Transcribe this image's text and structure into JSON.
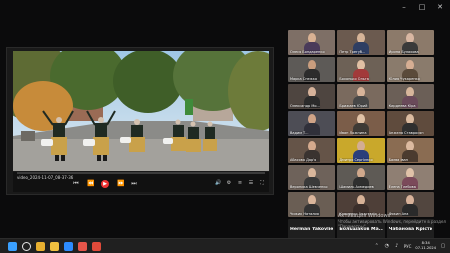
{
  "window_controls": [
    "minimize",
    "maximize",
    "close"
  ],
  "player": {
    "file_name": "video_2024-11-07_08-37-36",
    "progress": 0.0,
    "controls": [
      "prev-icon",
      "rewind-icon",
      "play-icon",
      "forward-icon",
      "next-icon"
    ],
    "right_controls": [
      "volume-icon",
      "settings-icon",
      "subtitles-icon",
      "playlist-icon",
      "fullscreen-icon"
    ]
  },
  "participants": [
    {
      "name": "Олеся Бондаренко",
      "skin": "#d9b193",
      "shirt": "#4a3a5a",
      "bg": "#7e6f66"
    },
    {
      "name": "Петр Трегуб...",
      "skin": "#d6b498",
      "shirt": "#2e3e63",
      "bg": "#6b5a4f"
    },
    {
      "name": "Ирина Булахова",
      "skin": "#d9b7a2",
      "shirt": "#3a3a3a",
      "bg": "#8c7a6a"
    },
    {
      "name": "Марка Снежко",
      "skin": "#c99d7e",
      "shirt": "#2c2c2c",
      "bg": "#5d5a57"
    },
    {
      "name": "Бохонько Ольга",
      "skin": "#e0c0a4",
      "shirt": "#a23a3a",
      "bg": "#6d6156"
    },
    {
      "name": "Юлия Чукаренко",
      "skin": "#d6ae93",
      "shirt": "#5a4a3a",
      "bg": "#8a7b6c"
    },
    {
      "name": "Олександр Мо...",
      "skin": "#d6b29a",
      "shirt": "#2b2b2b",
      "bg": "#4e4540"
    },
    {
      "name": "Брижаев Юрий",
      "skin": "#d8b49a",
      "shirt": "#474747",
      "bg": "#7a6a5e"
    },
    {
      "name": "Кирдеева Кіра",
      "skin": "#d7b69b",
      "shirt": "#6a4a5a",
      "bg": "#6b5f57"
    },
    {
      "name": "Вадим Т...",
      "skin": "#cfa387",
      "shirt": "#30303a",
      "bg": "#4d4d55"
    },
    {
      "name": "Иван Ложнина",
      "skin": "#e1c2a6",
      "shirt": "#3e3a35",
      "bg": "#7b5d49"
    },
    {
      "name": "Анжела Ставросян",
      "skin": "#dbbba0",
      "shirt": "#2f2f2f",
      "bg": "#5f4b3d"
    },
    {
      "name": "Абасова Дар'я",
      "skin": "#d4aa8e",
      "shirt": "#3a3330",
      "bg": "#655448"
    },
    {
      "name": "Дмитро Сергієнко",
      "skin": "#d3ad93",
      "shirt": "#2a3f7a",
      "bg": "#c9a82b"
    },
    {
      "name": "Баєва Іван",
      "skin": "#dcbaa0",
      "shirt": "#4b3b2f",
      "bg": "#8a6c52"
    },
    {
      "name": "Вероника Шевченко",
      "skin": "#dab79c",
      "shirt": "#3a3a3a",
      "bg": "#6e625a"
    },
    {
      "name": "Шамиль Ахмедиев",
      "skin": "#d0a88c",
      "shirt": "#2f2f2f",
      "bg": "#5e5a55"
    },
    {
      "name": "Елена Глебова",
      "skin": "#e0c2a8",
      "shirt": "#7b4a5a",
      "bg": "#8f7f73"
    },
    {
      "name": "Чижик Наталия",
      "skin": "#d9b59b",
      "shirt": "#333333",
      "bg": "#6a5e54"
    },
    {
      "name": "Кременко Анастасія",
      "skin": "#d7b297",
      "shirt": "#3a2e2a",
      "bg": "#4e3f38"
    },
    {
      "name": "Фокин Ана",
      "skin": "#d8b29a",
      "shirt": "#2a2a2a",
      "bg": "#52463f"
    }
  ],
  "name_tiles": [
    {
      "big": "Herman Yakovliev",
      "small": "Herman Yakovliev"
    },
    {
      "big": "Большаков Ма...",
      "small": "Большаков Максим"
    },
    {
      "big": "Чабанова Крістина",
      "small": "Чабанова Крістина"
    }
  ],
  "watermark": {
    "title": "Активация Windows",
    "line": "Чтобы активировать Windows, перейдите в раздел \"Параметры\"."
  },
  "taskbar": {
    "apps": [
      {
        "name": "windows-start-icon",
        "color": "#3aa0ff"
      },
      {
        "name": "search-icon",
        "color": "#e6e6e6"
      },
      {
        "name": "chrome-icon",
        "color": "#e8b030"
      },
      {
        "name": "explorer-icon",
        "color": "#f0c040"
      },
      {
        "name": "zoom-icon",
        "color": "#2d8cff"
      },
      {
        "name": "media-player-icon",
        "color": "#e6554a"
      },
      {
        "name": "yandex-icon",
        "color": "#e04a3a"
      }
    ],
    "lang": "РУС",
    "time": "8:34",
    "date": "07.11.2024"
  }
}
